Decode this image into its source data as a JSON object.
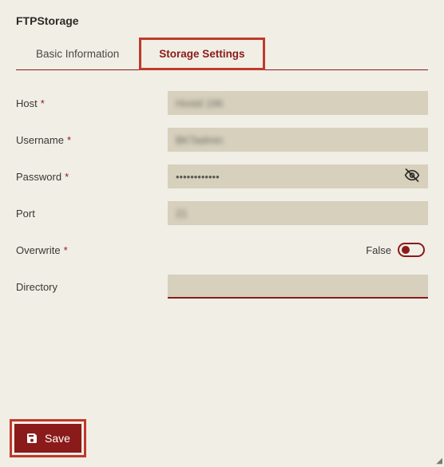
{
  "title": "FTPStorage",
  "tabs": {
    "basic": "Basic Information",
    "storage": "Storage Settings"
  },
  "fields": {
    "host": {
      "label": "Host",
      "value": "Hostd 196",
      "required": true
    },
    "username": {
      "label": "Username",
      "value": "BKTadmin",
      "required": true
    },
    "password": {
      "label": "Password",
      "value": "••••••••••••",
      "required": true
    },
    "port": {
      "label": "Port",
      "value": "21",
      "required": false
    },
    "overwrite": {
      "label": "Overwrite",
      "value": "False",
      "required": true
    },
    "directory": {
      "label": "Directory",
      "value": "",
      "required": false
    }
  },
  "buttons": {
    "save": "Save"
  }
}
